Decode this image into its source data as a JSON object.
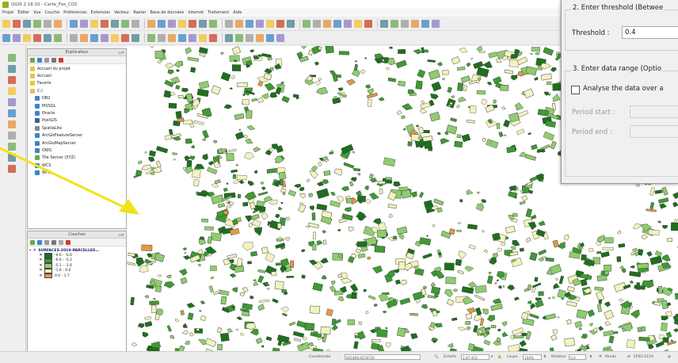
{
  "window": {
    "title": "QGIS 2.18.10 - Carte_Fox_CO2"
  },
  "menu": [
    "Projet",
    "Éditer",
    "Vue",
    "Couche",
    "Préférences",
    "Extension",
    "Vecteur",
    "Raster",
    "Base de données",
    "Internet",
    "Traitement",
    "Aide"
  ],
  "browser_panel": {
    "title": "Explorateur",
    "items": [
      {
        "label": "Accueil du projet",
        "icon": "home-icon",
        "indent": 0
      },
      {
        "label": "Accueil",
        "icon": "folder-icon",
        "indent": 0
      },
      {
        "label": "Favoris",
        "icon": "star-icon",
        "indent": 0
      },
      {
        "label": "C:/",
        "icon": "folder-icon",
        "indent": 0
      },
      {
        "label": "DB2",
        "icon": "database-icon",
        "indent": 1
      },
      {
        "label": "MSSQL",
        "icon": "database-icon",
        "indent": 1
      },
      {
        "label": "Oracle",
        "icon": "database-icon",
        "indent": 1
      },
      {
        "label": "PostGIS",
        "icon": "elephant-icon",
        "indent": 1
      },
      {
        "label": "SpatiaLite",
        "icon": "feather-icon",
        "indent": 1
      },
      {
        "label": "ArcGisFeatureServer",
        "icon": "globe-icon",
        "indent": 1
      },
      {
        "label": "ArcGisMapServer",
        "icon": "globe-icon",
        "indent": 1
      },
      {
        "label": "OWS",
        "icon": "globe-icon",
        "indent": 1
      },
      {
        "label": "Tile Server (XYZ)",
        "icon": "grid-icon",
        "indent": 1
      },
      {
        "label": "WCS",
        "icon": "globe-icon",
        "indent": 1
      },
      {
        "label": "WFS",
        "icon": "globe-icon",
        "indent": 1
      }
    ]
  },
  "layers_panel": {
    "title": "Couches",
    "layer_name": "SURFACES-2019-PARCELLES...",
    "classes": [
      {
        "label": "-9.6 - -6.6",
        "color": "#1f6f1f"
      },
      {
        "label": "-6.6 - -5.1",
        "color": "#3f9a34"
      },
      {
        "label": "-5.1 - -1.6",
        "color": "#8fcc6f"
      },
      {
        "label": "-1.6 - 0.0",
        "color": "#f3f3c0"
      },
      {
        "label": "0.0 - 1.7",
        "color": "#e09a4a"
      }
    ]
  },
  "plugin_dialog": {
    "section2_title": "2. Enter threshold (Betwee",
    "threshold_label": "Threshold :",
    "threshold_value": "0.4",
    "section3_title": "3. Enter data range (Optio",
    "checkbox_label": "Analyse the data over a",
    "period_start_label": "Period start :",
    "period_end_label": "Period end :"
  },
  "statusbar": {
    "coord_label": "Coordonnée",
    "coord_value": "841868,6578720",
    "scale_label": "Échelle",
    "scale_value": "1:87 453",
    "magnifier_label": "Loupe",
    "magnifier_value": "100%",
    "rotation_label": "Rotation",
    "rotation_value": "0,0",
    "render_label": "Rendu",
    "crs_label": "EPSG:2154"
  },
  "colors": {
    "dark_green": "#1f6f1f",
    "mid_green": "#3f9a34",
    "light_green": "#8fcc6f",
    "pale_yellow": "#f3f3c0",
    "orange": "#e09a4a",
    "annotation_arrow": "#f2e21a"
  }
}
